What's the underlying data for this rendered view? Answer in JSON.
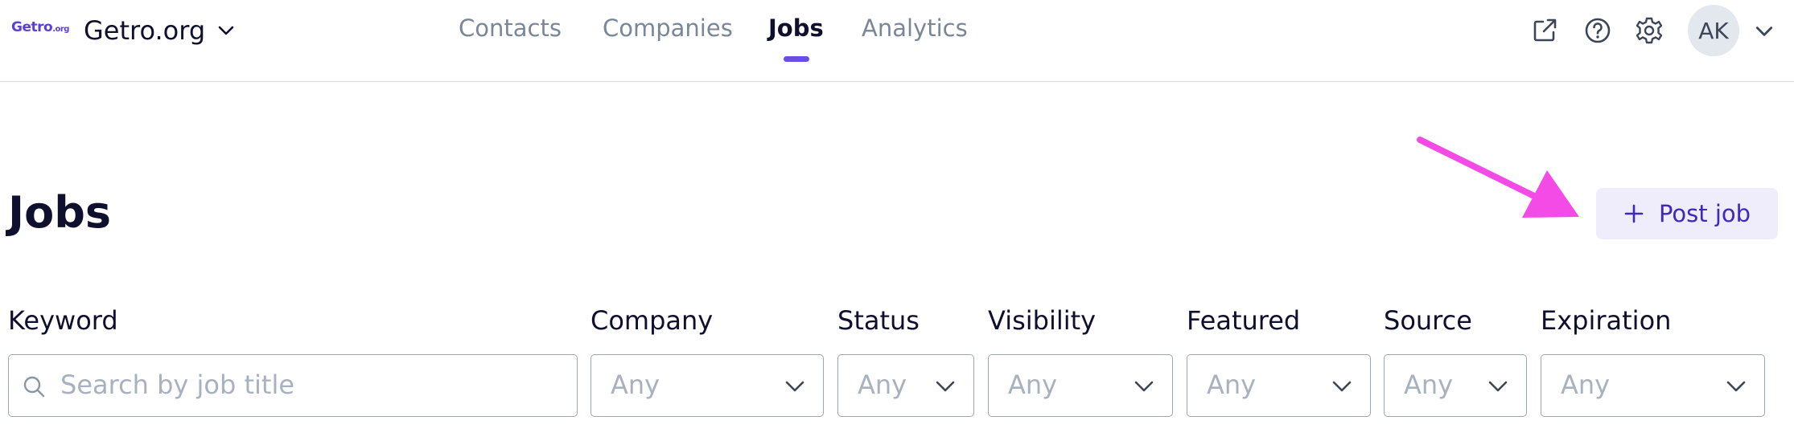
{
  "header": {
    "logo_main": "Getro",
    "logo_suffix": ".org",
    "org_name": "Getro.org",
    "nav": [
      {
        "label": "Contacts"
      },
      {
        "label": "Companies"
      },
      {
        "label": "Jobs"
      },
      {
        "label": "Analytics"
      }
    ],
    "active_tab": "Jobs",
    "icons": [
      "external-link-icon",
      "help-icon",
      "settings-icon"
    ],
    "avatar_initials": "AK"
  },
  "page": {
    "title": "Jobs",
    "post_job_label": "Post job",
    "annotation": "magenta arrow pointing at Post job"
  },
  "filters": [
    {
      "label": "Keyword",
      "placeholder": "Search by job title",
      "type": "search"
    },
    {
      "label": "Company",
      "value": "Any"
    },
    {
      "label": "Status",
      "value": "Any"
    },
    {
      "label": "Visibility",
      "value": "Any"
    },
    {
      "label": "Featured",
      "value": "Any"
    },
    {
      "label": "Source",
      "value": "Any"
    },
    {
      "label": "Expiration",
      "value": "Any"
    }
  ],
  "colors": {
    "accent": "#6b4ee6",
    "button_bg": "#efecfc",
    "button_text": "#4028b8",
    "annotation_arrow": "#f44be6"
  }
}
